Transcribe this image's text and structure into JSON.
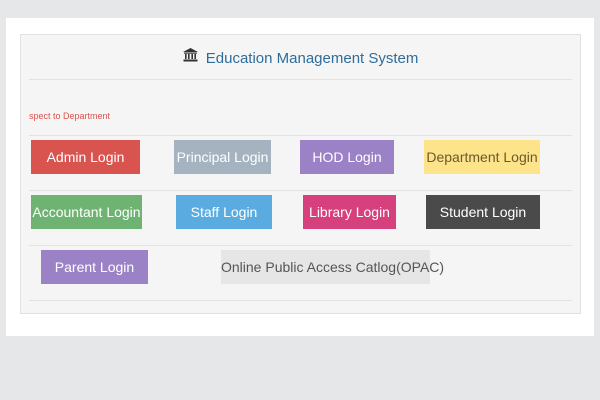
{
  "header": {
    "title": "Education Management System",
    "icon": "institution-icon"
  },
  "marquee": {
    "text": "spect to Department"
  },
  "buttons": {
    "admin": {
      "label": "Admin Login",
      "color": "#d9534f"
    },
    "principal": {
      "label": "Principal Login",
      "color": "#a4b3bf"
    },
    "hod": {
      "label": "HOD Login",
      "color": "#9b82c6"
    },
    "department": {
      "label": "Department Login",
      "color": "#fde38a"
    },
    "accountant": {
      "label": "Accountant Login",
      "color": "#6fb373"
    },
    "staff": {
      "label": "Staff Login",
      "color": "#5aace0"
    },
    "library": {
      "label": "Library Login",
      "color": "#d6407c"
    },
    "student": {
      "label": "Student Login",
      "color": "#4a4a4a"
    },
    "parent": {
      "label": "Parent Login",
      "color": "#9b82c6"
    },
    "opac": {
      "label": "Online Public Access Catlog(OPAC)",
      "color": "#e6e6e6"
    }
  }
}
